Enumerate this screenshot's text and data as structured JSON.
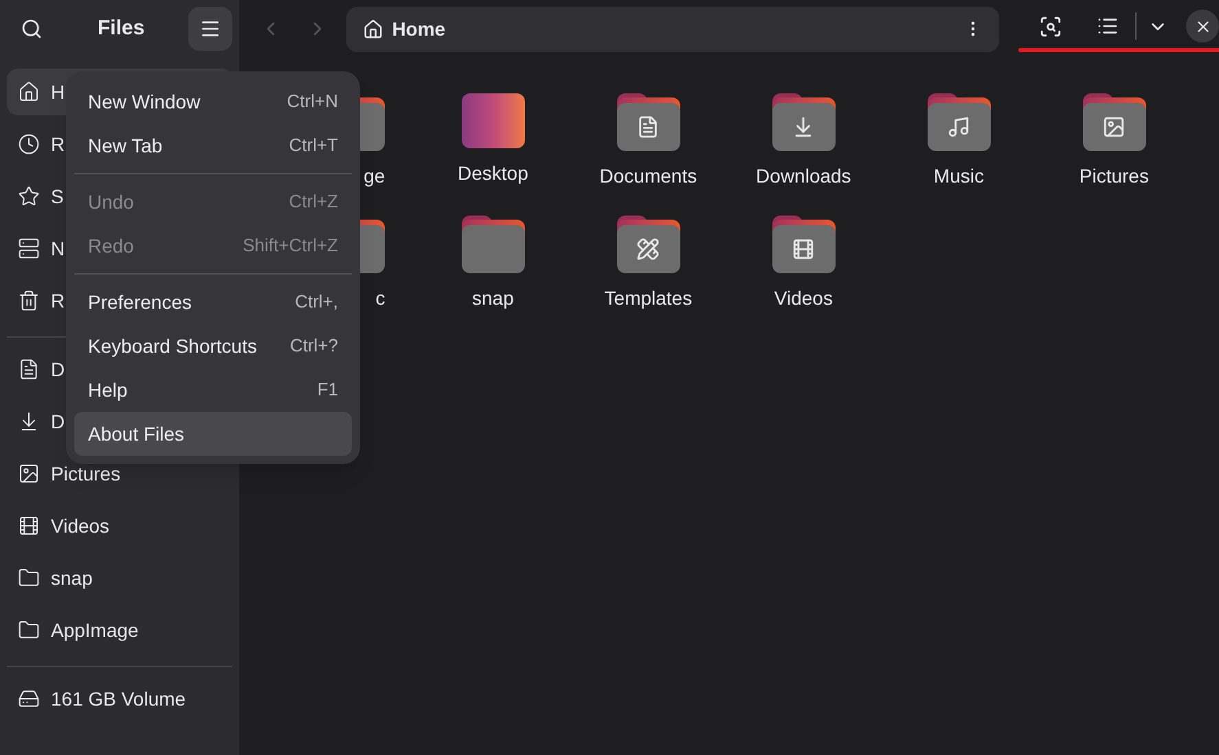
{
  "sidebar": {
    "title": "Files",
    "sections": [
      [
        {
          "label": "H",
          "kind": "home",
          "selected": true
        },
        {
          "label": "R",
          "kind": "recent",
          "selected": false
        },
        {
          "label": "S",
          "kind": "starred",
          "selected": false
        },
        {
          "label": "N",
          "kind": "network",
          "selected": false
        },
        {
          "label": "R",
          "kind": "trash",
          "selected": false
        }
      ],
      [
        {
          "label": "D",
          "kind": "documents",
          "selected": false
        },
        {
          "label": "D",
          "kind": "downloads",
          "selected": false
        },
        {
          "label": "Pictures",
          "kind": "pictures",
          "selected": false
        },
        {
          "label": "Videos",
          "kind": "videos",
          "selected": false
        },
        {
          "label": "snap",
          "kind": "folder",
          "selected": false
        },
        {
          "label": "AppImage",
          "kind": "folder",
          "selected": false
        }
      ],
      [
        {
          "label": "161 GB Volume",
          "kind": "drive",
          "selected": false
        }
      ]
    ]
  },
  "path_bar": {
    "label": "Home"
  },
  "menu": {
    "sections": [
      [
        {
          "label": "New Window",
          "shortcut": "Ctrl+N",
          "disabled": false,
          "selected": false
        },
        {
          "label": "New Tab",
          "shortcut": "Ctrl+T",
          "disabled": false,
          "selected": false
        }
      ],
      [
        {
          "label": "Undo",
          "shortcut": "Ctrl+Z",
          "disabled": true,
          "selected": false
        },
        {
          "label": "Redo",
          "shortcut": "Shift+Ctrl+Z",
          "disabled": true,
          "selected": false
        }
      ],
      [
        {
          "label": "Preferences",
          "shortcut": "Ctrl+,",
          "disabled": false,
          "selected": false
        },
        {
          "label": "Keyboard Shortcuts",
          "shortcut": "Ctrl+?",
          "disabled": false,
          "selected": false
        },
        {
          "label": "Help",
          "shortcut": "F1",
          "disabled": false,
          "selected": false
        },
        {
          "label": "About Files",
          "disabled": false,
          "selected": true
        }
      ]
    ]
  },
  "files": [
    {
      "label": "ge",
      "kind": "folder"
    },
    {
      "label": "Desktop",
      "kind": "desktop"
    },
    {
      "label": "Documents",
      "kind": "documents"
    },
    {
      "label": "Downloads",
      "kind": "downloads"
    },
    {
      "label": "Music",
      "kind": "music"
    },
    {
      "label": "Pictures",
      "kind": "pictures"
    },
    {
      "label": "c",
      "kind": "folder"
    },
    {
      "label": "snap",
      "kind": "folder"
    },
    {
      "label": "Templates",
      "kind": "templates"
    },
    {
      "label": "Videos",
      "kind": "videos"
    }
  ]
}
